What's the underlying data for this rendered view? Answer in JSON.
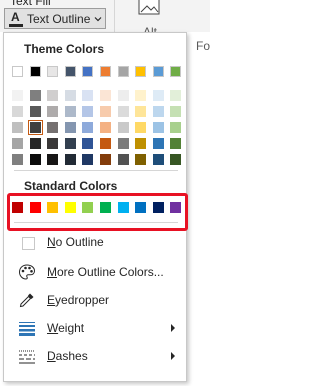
{
  "ribbon": {
    "partial_text": "Text Fill",
    "text_outline_label": "Text Outline",
    "alt_label": "Alt",
    "edge_label": "Fo"
  },
  "menu": {
    "theme_colors_title": "Theme Colors",
    "standard_colors_title": "Standard Colors",
    "theme_colors": [
      "#ffffff",
      "#000000",
      "#e7e6e6",
      "#44546a",
      "#4472c4",
      "#ed7d31",
      "#a5a5a5",
      "#ffc000",
      "#5b9bd5",
      "#70ad47"
    ],
    "theme_tints": [
      [
        "#f2f2f2",
        "#7f7f7f",
        "#d0cece",
        "#d6dce4",
        "#d9e2f3",
        "#fbe5d5",
        "#ededed",
        "#fff2cc",
        "#deebf6",
        "#e2efd9"
      ],
      [
        "#d8d8d8",
        "#595959",
        "#aeabab",
        "#adb9ca",
        "#b4c6e7",
        "#f7cbac",
        "#dbdbdb",
        "#fee599",
        "#bdd7ee",
        "#c5e0b3"
      ],
      [
        "#bfbfbf",
        "#3f3f3f",
        "#757070",
        "#8496b0",
        "#8eaadb",
        "#f4b183",
        "#c9c9c9",
        "#ffd965",
        "#9cc3e5",
        "#a8d08d"
      ],
      [
        "#a5a5a5",
        "#262626",
        "#3a3838",
        "#323f4f",
        "#2f5496",
        "#c45911",
        "#7b7b7b",
        "#bf9000",
        "#2e75b5",
        "#538135"
      ],
      [
        "#7f7f7f",
        "#0c0c0c",
        "#171616",
        "#222a35",
        "#1f3864",
        "#833c0b",
        "#525252",
        "#7f6000",
        "#1e4e79",
        "#375623"
      ]
    ],
    "standard_colors": [
      "#c00000",
      "#ff0000",
      "#ffc000",
      "#ffff00",
      "#92d050",
      "#00b050",
      "#00b0f0",
      "#0070c0",
      "#002060",
      "#7030a0"
    ],
    "items": {
      "no_outline": {
        "label_mnemonic": "N",
        "label_rest": "o Outline"
      },
      "more_colors": {
        "label_mnemonic": "M",
        "label_rest": "ore Outline Colors..."
      },
      "eyedropper": {
        "label_mnemonic": "E",
        "label_rest": "yedropper"
      },
      "weight": {
        "label_mnemonic": "W",
        "label_rest": "eight"
      },
      "dashes": {
        "label_mnemonic": "D",
        "label_rest": "ashes"
      }
    },
    "accent_colors": {
      "highlight": "#e81123",
      "selected_swatch": "#c55a11",
      "weight_icon": "#2e75b5"
    }
  }
}
